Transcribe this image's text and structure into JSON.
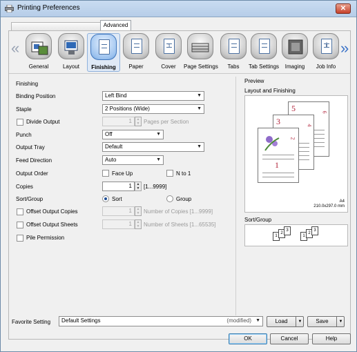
{
  "window": {
    "title": "Printing Preferences",
    "close_glyph": "✕"
  },
  "tabs": [
    "Advanced"
  ],
  "categories": [
    {
      "label": "General",
      "icon": "general-icon"
    },
    {
      "label": "Layout",
      "icon": "layout-icon"
    },
    {
      "label": "Finishing",
      "icon": "finishing-icon"
    },
    {
      "label": "Paper",
      "icon": "paper-icon"
    },
    {
      "label": "Cover",
      "icon": "cover-icon"
    },
    {
      "label": "Page Settings",
      "icon": "page-settings-icon"
    },
    {
      "label": "Tabs",
      "icon": "tabs-icon"
    },
    {
      "label": "Tab Settings",
      "icon": "tab-settings-icon"
    },
    {
      "label": "Imaging",
      "icon": "imaging-icon"
    },
    {
      "label": "Job Info",
      "icon": "job-info-icon"
    }
  ],
  "finishing": {
    "group_title": "Finishing",
    "binding_position": {
      "label": "Binding Position",
      "value": "Left Bind"
    },
    "staple": {
      "label": "Staple",
      "value": "2 Positions (Wide)"
    },
    "divide_output": {
      "label": "Divide Output",
      "value": "1",
      "unit": "Pages per Section"
    },
    "punch": {
      "label": "Punch",
      "value": "Off"
    },
    "output_tray": {
      "label": "Output Tray",
      "value": "Default"
    },
    "feed_direction": {
      "label": "Feed Direction",
      "value": "Auto"
    },
    "output_order": {
      "label": "Output Order",
      "face_up": "Face Up",
      "n_to_1": "N to 1"
    },
    "copies": {
      "label": "Copies",
      "value": "1",
      "range": "[1...9999]"
    },
    "sort_group": {
      "label": "Sort/Group",
      "sort": "Sort",
      "group": "Group"
    },
    "offset_output_copies": {
      "label": "Offset Output Copies",
      "value": "1",
      "unit": "Number of Copies [1...9999]"
    },
    "offset_output_sheets": {
      "label": "Offset Output Sheets",
      "value": "1",
      "unit": "Number of Sheets [1...65535]"
    },
    "pile_permission": {
      "label": "Pile Permission"
    }
  },
  "preview": {
    "title": "Preview",
    "subtitle": "Layout and Finishing",
    "page_numbers": [
      "1",
      "2",
      "3",
      "4",
      "5",
      "6"
    ],
    "paper_size": "A4",
    "paper_dims": "210.0x297.0 mm",
    "sortgroup_title": "Sort/Group",
    "sortgroup_pages": [
      "1",
      "2",
      "3",
      "1",
      "2",
      "3"
    ]
  },
  "favorite": {
    "label": "Favorite Setting",
    "value": "Default Settings",
    "state": "(modified)",
    "load": "Load",
    "save": "Save"
  },
  "buttons": {
    "ok": "OK",
    "cancel": "Cancel",
    "help": "Help"
  }
}
